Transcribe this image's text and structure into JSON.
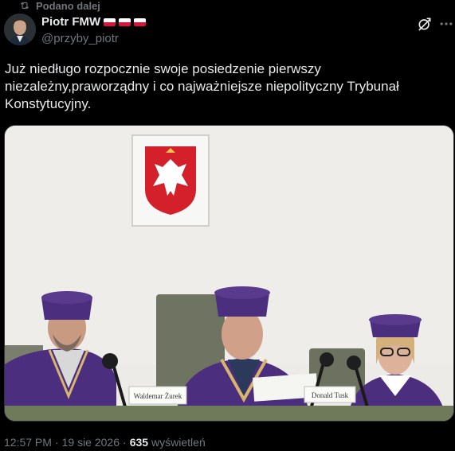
{
  "repost": {
    "label": "Podano dalej",
    "icon": "repost-icon"
  },
  "author": {
    "display_name": "Piotr FMW",
    "flags": [
      "poland-flag",
      "poland-flag",
      "poland-flag"
    ],
    "handle": "@przyby_piotr"
  },
  "header_actions": {
    "grok_icon": "grok-icon",
    "more_icon": "more-icon"
  },
  "tweet": {
    "text": "Już niedługo rozpocznie swoje posiedzenie pierwszy\nniezależny,praworządny i co najważniejsze niepolityczny Trybunał\nKonstytucyjny."
  },
  "media": {
    "nameplates": [
      "Waldemar Żurek",
      "Donald Tusk"
    ]
  },
  "meta": {
    "time": "12:57 PM",
    "separator": "·",
    "date": "19 sie 2026",
    "views_count": "635",
    "views_label": "wyświetleń"
  },
  "colors": {
    "background": "#000000",
    "text_primary": "#e7e9ea",
    "text_secondary": "#71767b",
    "robe_purple": "#4b2e7d",
    "flag_red": "#dc143c"
  }
}
